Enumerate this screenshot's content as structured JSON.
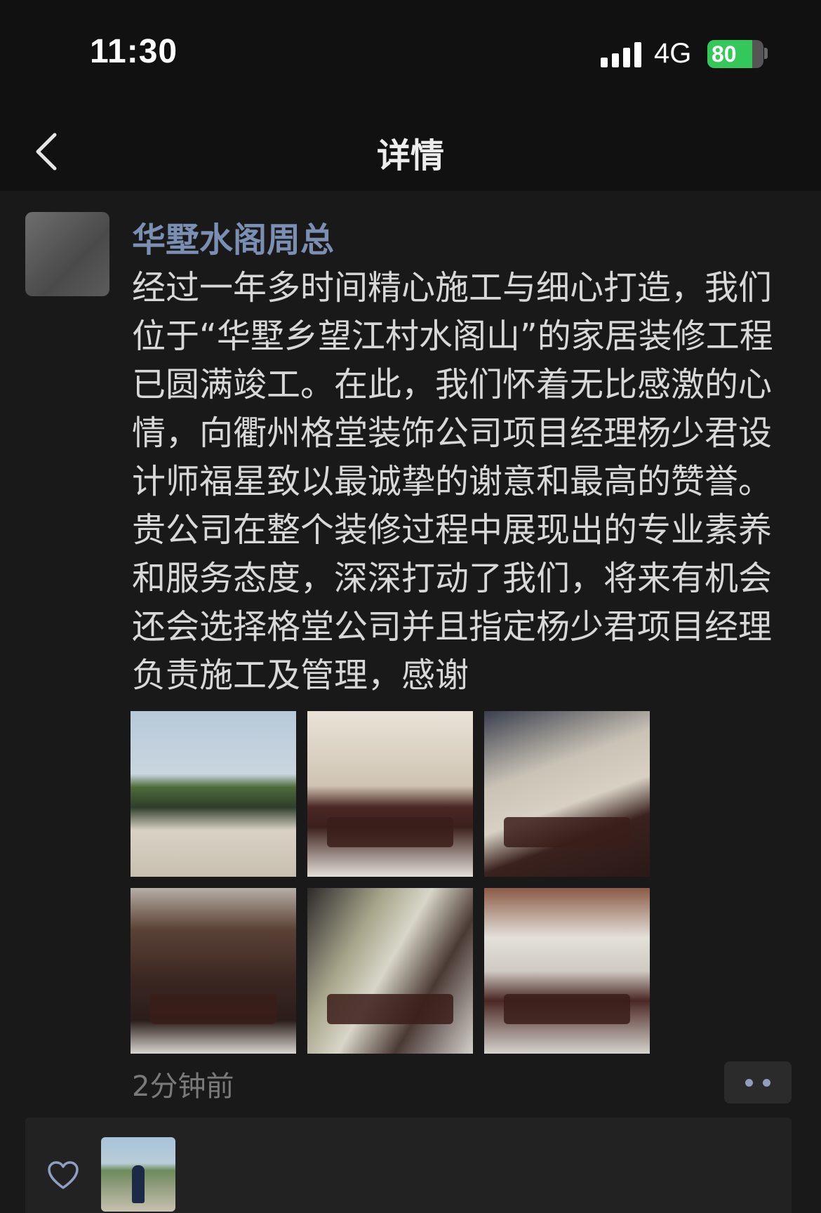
{
  "status_bar": {
    "time": "11:30",
    "network": "4G",
    "battery_percent": "80",
    "battery_level": 0.8,
    "charging": true
  },
  "nav": {
    "title": "详情",
    "back_icon": "chevron-left-icon"
  },
  "post": {
    "author": "华墅水阁周总",
    "text": "经过一年多时间精心施工与细心打造，我们位于“华墅乡望江村水阁山”的家居装修工程已圆满竣工。在此，我们怀着无比感激的心情，向衢州格堂装饰公司项目经理杨少君设计师福星致以最诚挚的谢意和最高的赞誉。贵公司在整个装修过程中展现出的专业素养和服务态度，深深打动了我们，将来有机会还会选择格堂公司并且指定杨少君项目经理负责施工及管理，感谢",
    "timestamp": "2分钟前",
    "photo_count": 6
  },
  "likes": {
    "heart_icon": "heart-outline-icon"
  },
  "colors": {
    "background": "#191919",
    "bar": "#111111",
    "author_name": "#7b8fb3",
    "body_text": "#d8d8d8",
    "timestamp": "#7a7a7a",
    "battery_green": "#34c759"
  }
}
